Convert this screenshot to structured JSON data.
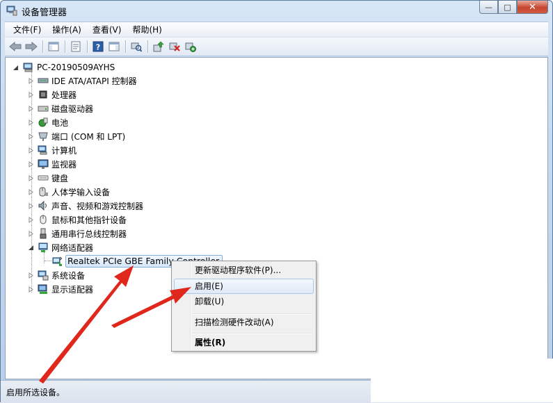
{
  "window": {
    "title": "设备管理器",
    "controls": {
      "minimize": "—",
      "maximize": "□",
      "close": "✕"
    }
  },
  "menu": [
    "文件(F)",
    "操作(A)",
    "查看(V)",
    "帮助(H)"
  ],
  "toolbar": [
    "back-icon",
    "forward-icon",
    "show-hide-console-tree-icon",
    "properties-icon",
    "help-icon",
    "show-hide-action-pane-icon",
    "scan-hardware-icon",
    "update-driver-icon",
    "uninstall-icon",
    "enable-device-icon"
  ],
  "tree": {
    "root": "PC-20190509AYHS",
    "categories": [
      {
        "label": "IDE ATA/ATAPI 控制器",
        "icon": "ide-controller-icon"
      },
      {
        "label": "处理器",
        "icon": "processor-icon"
      },
      {
        "label": "磁盘驱动器",
        "icon": "disk-drive-icon"
      },
      {
        "label": "电池",
        "icon": "battery-icon"
      },
      {
        "label": "端口 (COM 和 LPT)",
        "icon": "port-icon"
      },
      {
        "label": "计算机",
        "icon": "computer-icon"
      },
      {
        "label": "监视器",
        "icon": "monitor-icon"
      },
      {
        "label": "键盘",
        "icon": "keyboard-icon"
      },
      {
        "label": "人体学输入设备",
        "icon": "hid-icon"
      },
      {
        "label": "声音、视频和游戏控制器",
        "icon": "sound-icon"
      },
      {
        "label": "鼠标和其他指针设备",
        "icon": "mouse-icon"
      },
      {
        "label": "通用串行总线控制器",
        "icon": "usb-icon"
      },
      {
        "label": "网络适配器",
        "icon": "network-adapter-icon"
      }
    ],
    "network_child": "Realtek PCIe GBE Family Controller",
    "categories_after": [
      {
        "label": "系统设备",
        "icon": "system-devices-icon"
      },
      {
        "label": "显示适配器",
        "icon": "display-adapter-icon"
      }
    ]
  },
  "context_menu": {
    "update_driver": "更新驱动程序软件(P)...",
    "enable": "启用(E)",
    "uninstall": "卸载(U)",
    "scan": "扫描检测硬件改动(A)",
    "properties_prefix": "属性",
    "properties_key": "(R)"
  },
  "status": {
    "text": "启用所选设备。"
  },
  "colors": {
    "arrow": "#e0271c",
    "selection_border": "#84acdd"
  }
}
